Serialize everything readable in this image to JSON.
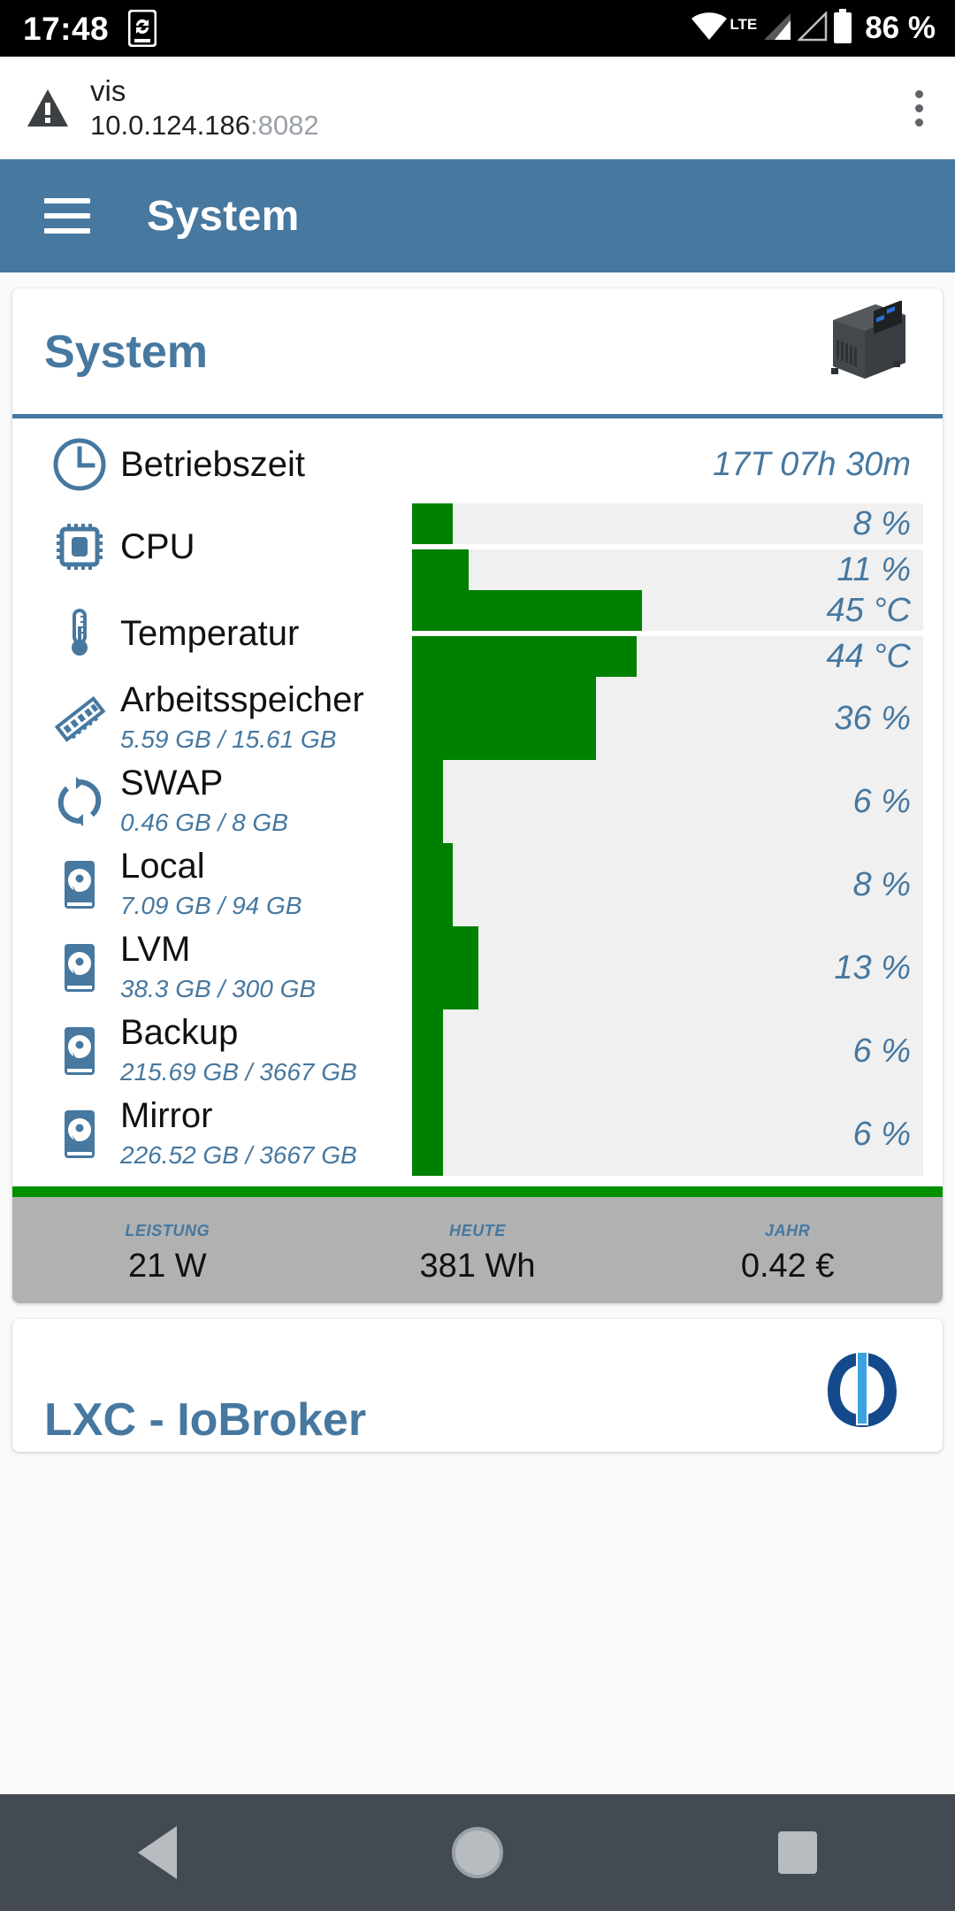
{
  "statusbar": {
    "time": "17:48",
    "sync_icon": "phone-sync-icon",
    "wifi_icon": "wifi-icon",
    "network_type": "LTE",
    "signal1_icon": "signal-bars-icon",
    "signal2_icon": "signal-bars-empty-icon",
    "battery_icon": "battery-icon",
    "battery_percent": "86 %"
  },
  "browser": {
    "security_icon": "warning-triangle-icon",
    "page_title": "vis",
    "host": "10.0.124.186",
    "port": ":8082",
    "menu_icon": "overflow-menu-icon"
  },
  "appbar": {
    "menu_icon": "hamburger-menu-icon",
    "title": "System"
  },
  "card": {
    "title": "System",
    "thumbnail_icon": "mini-pc-image",
    "rows": [
      {
        "icon": "clock-icon",
        "name": "Betriebszeit",
        "sub": "",
        "type": "text",
        "values": [
          {
            "label": "17T 07h 30m"
          }
        ]
      },
      {
        "icon": "cpu-chip-icon",
        "name": "CPU",
        "sub": "",
        "type": "bars",
        "values": [
          {
            "label": "8 %",
            "percent": 8
          },
          {
            "label": "11 %",
            "percent": 11
          }
        ]
      },
      {
        "icon": "thermometer-icon",
        "name": "Temperatur",
        "sub": "",
        "type": "bars",
        "values": [
          {
            "label": "45 °C",
            "percent": 45
          },
          {
            "label": "44 °C",
            "percent": 44
          }
        ]
      },
      {
        "icon": "ram-module-icon",
        "name": "Arbeitsspeicher",
        "sub": "5.59 GB / 15.61 GB",
        "type": "bar-tall",
        "values": [
          {
            "label": "36 %",
            "percent": 36
          }
        ]
      },
      {
        "icon": "swap-refresh-icon",
        "name": "SWAP",
        "sub": "0.46 GB / 8 GB",
        "type": "bar-tall",
        "values": [
          {
            "label": "6 %",
            "percent": 6
          }
        ]
      },
      {
        "icon": "hard-disk-icon",
        "name": "Local",
        "sub": "7.09 GB / 94 GB",
        "type": "bar-tall",
        "values": [
          {
            "label": "8 %",
            "percent": 8
          }
        ]
      },
      {
        "icon": "hard-disk-icon",
        "name": "LVM",
        "sub": "38.3 GB / 300 GB",
        "type": "bar-tall",
        "values": [
          {
            "label": "13 %",
            "percent": 13
          }
        ]
      },
      {
        "icon": "hard-disk-icon",
        "name": "Backup",
        "sub": "215.69 GB / 3667 GB",
        "type": "bar-tall",
        "values": [
          {
            "label": "6 %",
            "percent": 6
          }
        ]
      },
      {
        "icon": "hard-disk-icon",
        "name": "Mirror",
        "sub": "226.52 GB / 3667 GB",
        "type": "bar-tall",
        "values": [
          {
            "label": "6 %",
            "percent": 6
          }
        ]
      }
    ],
    "footer_stats": [
      {
        "label": "Leistung",
        "value": "21 W"
      },
      {
        "label": "Heute",
        "value": "381 Wh"
      },
      {
        "label": "Jahr",
        "value": "0.42 €"
      }
    ]
  },
  "card2": {
    "title": "LXC - IoBroker",
    "logo_icon": "iobroker-logo"
  },
  "navbar": {
    "back_icon": "back-triangle-icon",
    "home_icon": "home-circle-icon",
    "recents_icon": "recents-square-icon"
  },
  "colors": {
    "accent_blue": "#4678a0",
    "bar_green": "#008000",
    "footer_green": "#009000",
    "footer_gray": "#b1b1b1"
  }
}
